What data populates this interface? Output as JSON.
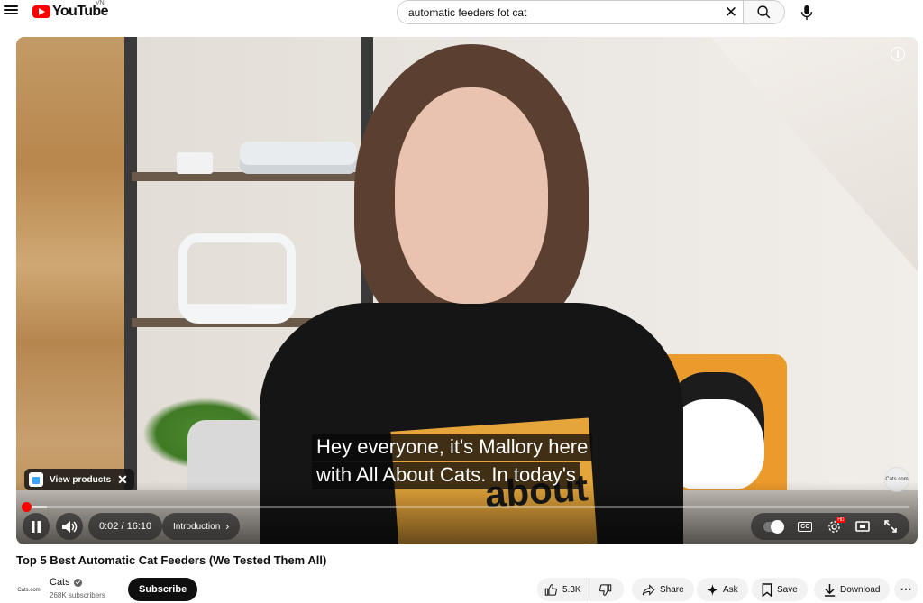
{
  "header": {
    "logo_text": "YouTube",
    "country_code": "VN",
    "search_value": "automatic feeders fot cat"
  },
  "player": {
    "captions": [
      "Hey everyone, it's Mallory here",
      "with All About Cats. In today's"
    ],
    "products_label": "View products",
    "time": "0:02 / 16:10",
    "chapter": "Introduction",
    "progress_fraction": 0.0021,
    "watermark_text": "Cats.com",
    "shirt_text": "about"
  },
  "video": {
    "title": "Top 5 Best Automatic Cat Feeders (We Tested Them All)"
  },
  "channel": {
    "logo_text": "Cats.com",
    "name": "Cats",
    "subscribers": "268K subscribers",
    "subscribe_label": "Subscribe"
  },
  "actions": {
    "likes": "5.3K",
    "share": "Share",
    "ask": "Ask",
    "save": "Save",
    "download": "Download"
  },
  "colors": {
    "brand_red": "#ff0000",
    "pillow": "#eb9a2c"
  }
}
